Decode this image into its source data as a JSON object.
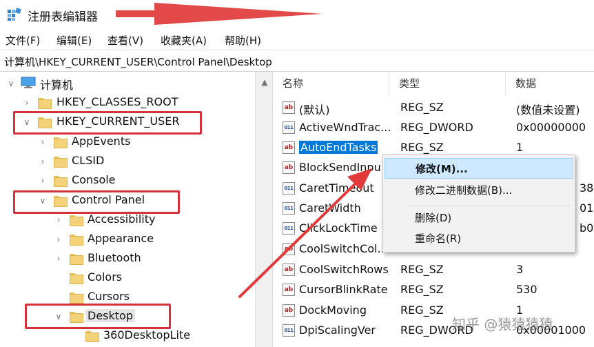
{
  "window": {
    "title": "注册表编辑器"
  },
  "menu": [
    "文件(F)",
    "编辑(E)",
    "查看(V)",
    "收藏夹(A)",
    "帮助(H)"
  ],
  "address": "计算机\\HKEY_CURRENT_USER\\Control Panel\\Desktop",
  "tree": {
    "root": "计算机",
    "hkcr": "HKEY_CLASSES_ROOT",
    "hkcu": "HKEY_CURRENT_USER",
    "appevents": "AppEvents",
    "clsid": "CLSID",
    "console": "Console",
    "control_panel": "Control Panel",
    "accessibility": "Accessibility",
    "appearance": "Appearance",
    "bluetooth": "Bluetooth",
    "colors": "Colors",
    "cursors": "Cursors",
    "desktop": "Desktop",
    "desktop360": "360DesktopLite"
  },
  "columns": {
    "name": "名称",
    "type": "类型",
    "data": "数据"
  },
  "values": [
    {
      "icon": "ab",
      "name": "(默认)",
      "type": "REG_SZ",
      "data": "(数值未设置)"
    },
    {
      "icon": "bin",
      "name": "ActiveWndTrac...",
      "type": "REG_DWORD",
      "data": "0x00000000"
    },
    {
      "icon": "ab",
      "name": "AutoEndTasks",
      "type": "REG_SZ",
      "data": "1"
    },
    {
      "icon": "ab",
      "name": "BlockSendInpu",
      "type": "",
      "data": ""
    },
    {
      "icon": "bin",
      "name": "CaretTimeout",
      "type": "",
      "data": "38"
    },
    {
      "icon": "bin",
      "name": "CaretWidth",
      "type": "",
      "data": "01"
    },
    {
      "icon": "bin",
      "name": "ClickLockTime",
      "type": "",
      "data": "b0"
    },
    {
      "icon": "ab",
      "name": "CoolSwitchCol...",
      "type": "",
      "data": ""
    },
    {
      "icon": "ab",
      "name": "CoolSwitchRows",
      "type": "REG_SZ",
      "data": "3"
    },
    {
      "icon": "ab",
      "name": "CursorBlinkRate",
      "type": "REG_SZ",
      "data": "530"
    },
    {
      "icon": "ab",
      "name": "DockMoving",
      "type": "REG_SZ",
      "data": "1"
    },
    {
      "icon": "bin",
      "name": "DpiScalingVer",
      "type": "REG_DWORD",
      "data": "0x00001000"
    }
  ],
  "context_menu": {
    "modify": "修改(M)...",
    "modify_binary": "修改二进制数据(B)...",
    "delete": "删除(D)",
    "rename": "重命名(R)"
  },
  "watermark": "知乎 @猿猿猿猿",
  "colors": {
    "highlight_box": "#d6313d",
    "selection": "#0078d7",
    "menu_hover": "#cde8ff"
  }
}
